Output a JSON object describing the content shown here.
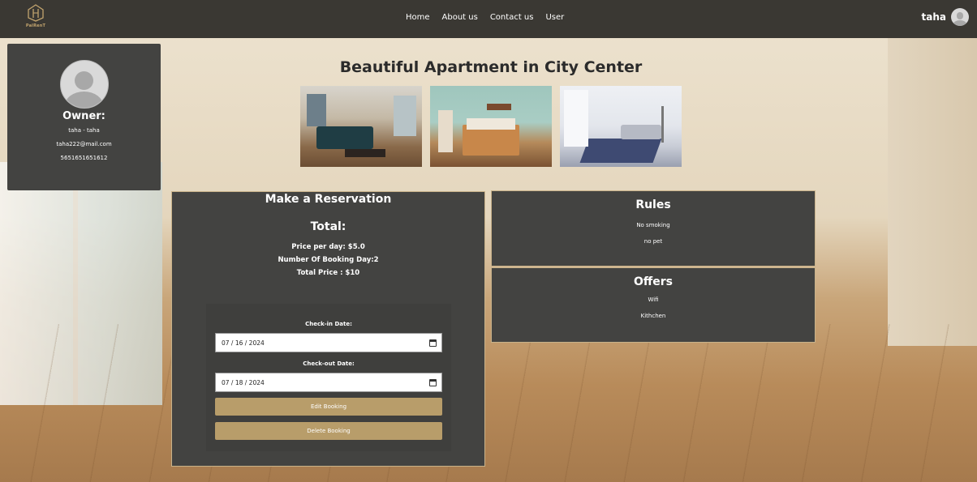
{
  "navbar": {
    "logo_text": "PalRenT",
    "links": [
      "Home",
      "About us",
      "Contact us",
      "User"
    ],
    "username": "taha"
  },
  "owner": {
    "heading": "Owner:",
    "name": "taha - taha",
    "email": "taha222@mail.com",
    "phone": "5651651651612"
  },
  "listing": {
    "title": "Beautiful Apartment in City Center"
  },
  "reservation": {
    "title": "Make a Reservation",
    "total_label": "Total:",
    "price_per_day": "Price per day: $5.0",
    "booking_days": "Number Of Booking Day:2",
    "total_price": "Total Price : $10",
    "checkin_label": "Check-in Date:",
    "checkin_value": "07 / 16 / 2024",
    "checkout_label": "Check-out Date:",
    "checkout_value": "07 / 18 / 2024",
    "edit_button": "Edit Booking",
    "delete_button": "Delete Booking"
  },
  "rules": {
    "title": "Rules",
    "items": [
      "No smoking",
      "no pet"
    ]
  },
  "offers": {
    "title": "Offers",
    "items": [
      "Wifi",
      "Kithchen"
    ]
  },
  "colors": {
    "navbar_bg": "#3a3833",
    "panel_bg": "#434341",
    "accent_button": "#b89d6a"
  }
}
